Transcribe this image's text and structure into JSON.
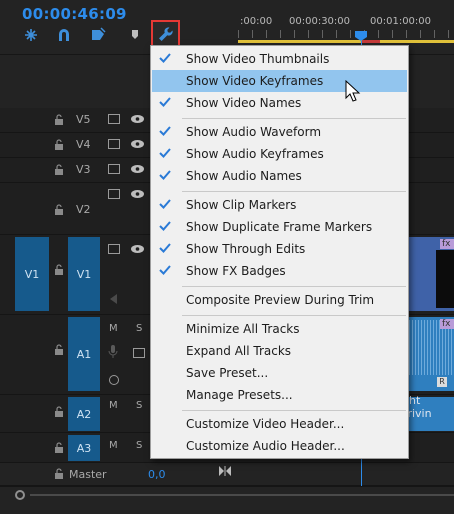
{
  "header": {
    "timecode": "00:00:46:09",
    "ruler_labels": [
      ":00:00",
      "00:00:30:00",
      "00:01:00:00"
    ]
  },
  "tools": [
    "snap-icon",
    "linked-selection-icon",
    "add-marker-icon",
    "marker-icon",
    "wrench-icon"
  ],
  "tracks": {
    "video": [
      {
        "label": "V5"
      },
      {
        "label": "V4"
      },
      {
        "label": "V3"
      },
      {
        "label": "V2"
      },
      {
        "label": "V1",
        "source": "V1"
      }
    ],
    "audio": [
      {
        "label": "A1",
        "m": "M",
        "s": "S"
      },
      {
        "label": "A2",
        "m": "M",
        "s": "S"
      },
      {
        "label": "A3",
        "m": "M",
        "s": "S"
      }
    ],
    "master": {
      "label": "Master",
      "value": "0,0"
    }
  },
  "timeline": {
    "fx_badge": "fx",
    "audio_clip_text": "ight Drivin",
    "r_badge": "R"
  },
  "menu": {
    "group1": [
      {
        "label": "Show Video Thumbnails",
        "checked": true
      },
      {
        "label": "Show Video Keyframes",
        "checked": false,
        "highlighted": true
      },
      {
        "label": "Show Video Names",
        "checked": true
      }
    ],
    "group2": [
      {
        "label": "Show Audio Waveform",
        "checked": true
      },
      {
        "label": "Show Audio Keyframes",
        "checked": true
      },
      {
        "label": "Show Audio Names",
        "checked": true
      }
    ],
    "group3": [
      {
        "label": "Show Clip Markers",
        "checked": true
      },
      {
        "label": "Show Duplicate Frame Markers",
        "checked": true
      },
      {
        "label": "Show Through Edits",
        "checked": true
      },
      {
        "label": "Show FX Badges",
        "checked": true
      }
    ],
    "group4": [
      {
        "label": "Composite Preview During Trim",
        "checked": false
      }
    ],
    "group5": [
      {
        "label": "Minimize All Tracks",
        "checked": false
      },
      {
        "label": "Expand All Tracks",
        "checked": false
      },
      {
        "label": "Save Preset...",
        "checked": false
      },
      {
        "label": "Manage Presets...",
        "checked": false
      }
    ],
    "group6": [
      {
        "label": "Customize Video Header...",
        "checked": false
      },
      {
        "label": "Customize Audio Header...",
        "checked": false
      }
    ]
  },
  "colors": {
    "accent_blue": "#2d8ceb",
    "highlight_red": "#e53935",
    "menu_highlight": "#92c5ee",
    "track_target": "#165a8c"
  }
}
